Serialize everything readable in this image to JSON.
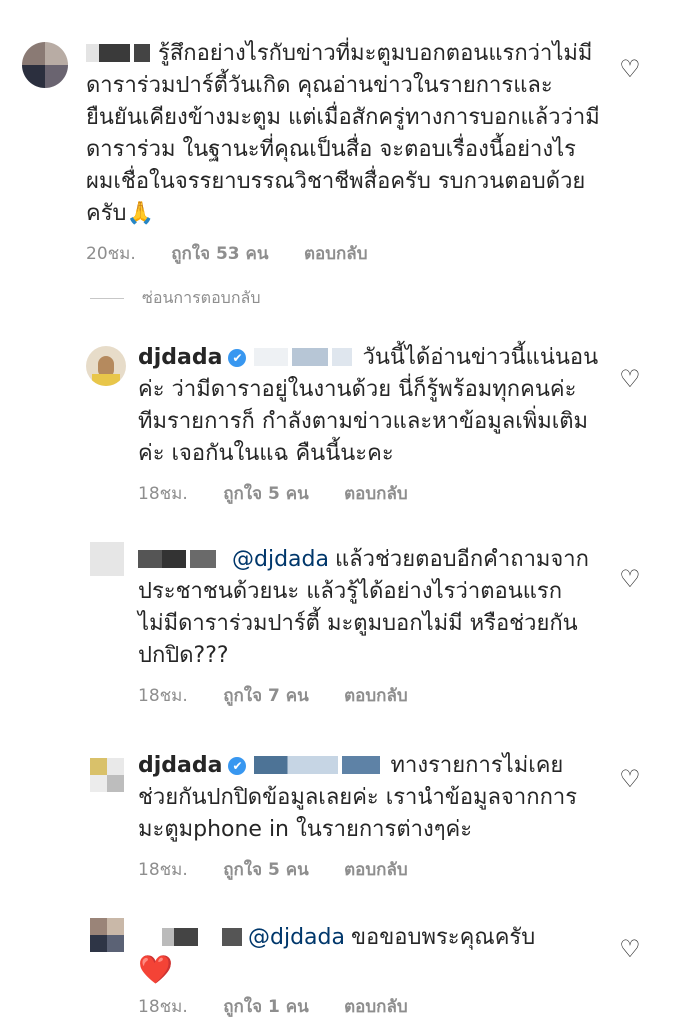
{
  "hide_replies_label": "ซ่อนการตอบกลับ",
  "like_icon": "heart-outline-icon",
  "verified_icon": "✔",
  "colors": {
    "text": "#262626",
    "meta": "#8e8e8e",
    "mention": "#00376b",
    "verified": "#3897f0"
  },
  "comments": [
    {
      "username": "",
      "mention": "",
      "text": "รู้สึกอย่างไรกับข่าวที่มะตูมบอกตอนแรกว่าไม่มีดาราร่วมปาร์ตี้วันเกิด คุณอ่านข่าวในรายการและยืนยันเคียงข้างมะตูม แต่เมื่อสักครู่ทางการบอกแล้วว่ามีดาราร่วม ในฐานะที่คุณเป็นสื่อ จะตอบเรื่องนี้อย่างไร ผมเชื่อในจรรยาบรรณวิชาชีพสื่อครับ รบกวนตอบด้วยครับ",
      "emoji": "🙏",
      "time": "20ชม.",
      "likes": "ถูกใจ 53 คน",
      "reply": "ตอบกลับ"
    },
    {
      "username": "djdada",
      "mention": "",
      "text": "วันนี้ได้อ่านข่าวนี้แน่นอนค่ะ ว่ามีดาราอยู่ในงานด้วย นี่ก็รู้พร้อมทุกคนค่ะ ทีมรายการก็ กำลังตามข่าวและหาข้อมูลเพิ่มเติมค่ะ เจอกันในแฉ คืนนี้นะคะ",
      "emoji": "",
      "time": "18ชม.",
      "likes": "ถูกใจ 5 คน",
      "reply": "ตอบกลับ"
    },
    {
      "username": "",
      "mention": "@djdada",
      "text": "แล้วช่วยตอบอีกคำถามจากประชาชนด้วยนะ แล้วรู้ได้อย่างไรว่าตอนแรกไม่มีดาราร่วมปาร์ตี้ มะตูมบอกไม่มี หรือช่วยกันปกปิด???",
      "emoji": "",
      "time": "18ชม.",
      "likes": "ถูกใจ 7 คน",
      "reply": "ตอบกลับ"
    },
    {
      "username": "djdada",
      "mention": "",
      "text": "ทางรายการไม่เคยช่วยกันปกปิดข้อมูลเลยค่ะ เรานำข้อมูลจากการมะตูมphone in ในรายการต่างๆค่ะ",
      "emoji": "",
      "time": "18ชม.",
      "likes": "ถูกใจ 5 คน",
      "reply": "ตอบกลับ"
    },
    {
      "username": "",
      "mention": "@djdada",
      "text": "ขอขอบพระคุณครับ",
      "emoji": "❤️",
      "time": "18ชม.",
      "likes": "ถูกใจ 1 คน",
      "reply": "ตอบกลับ"
    }
  ]
}
